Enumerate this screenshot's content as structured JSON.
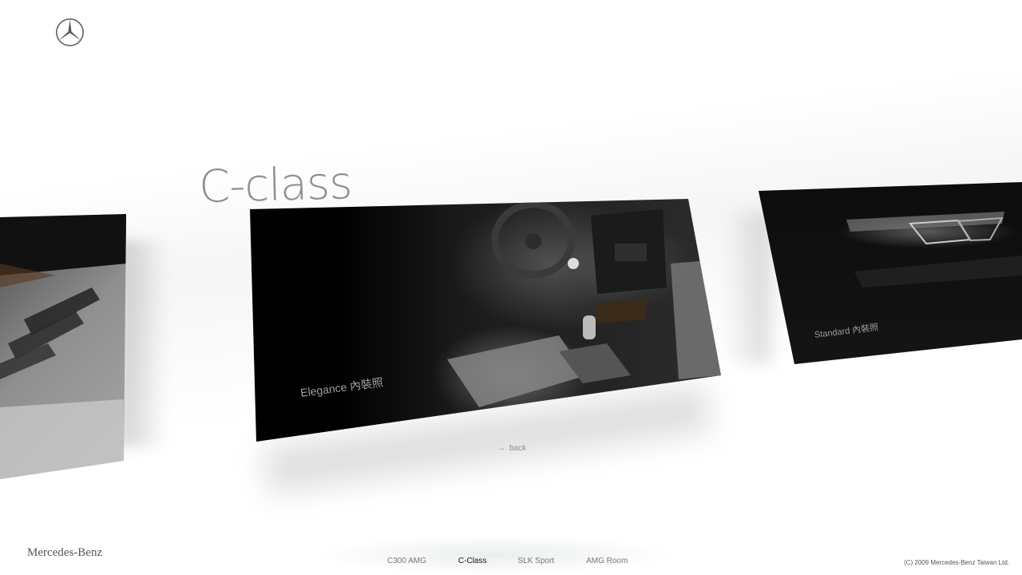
{
  "brand": {
    "logo_icon": "mercedes-star-icon",
    "wordmark": "Mercedes-Benz"
  },
  "page": {
    "title": "C-class"
  },
  "gallery": {
    "panels": [
      {
        "id": "left",
        "caption": ""
      },
      {
        "id": "main",
        "caption": "Elegance 內裝照"
      },
      {
        "id": "right",
        "caption": "Standard 內裝照"
      }
    ]
  },
  "back": {
    "icon": "arrow-right-icon",
    "label": "back"
  },
  "nav": {
    "items": [
      {
        "label": "C300 AMG",
        "active": false
      },
      {
        "label": "C-Class",
        "active": true
      },
      {
        "label": "SLK Sport",
        "active": false
      },
      {
        "label": "AMG Room",
        "active": false
      }
    ]
  },
  "footer": {
    "copyright": "(C) 2009 Mercedes-Benz Taiwan Ltd."
  },
  "colors": {
    "title_gray": "#8f8f8f",
    "active_nav": "#111111",
    "inactive_nav": "#777777"
  }
}
